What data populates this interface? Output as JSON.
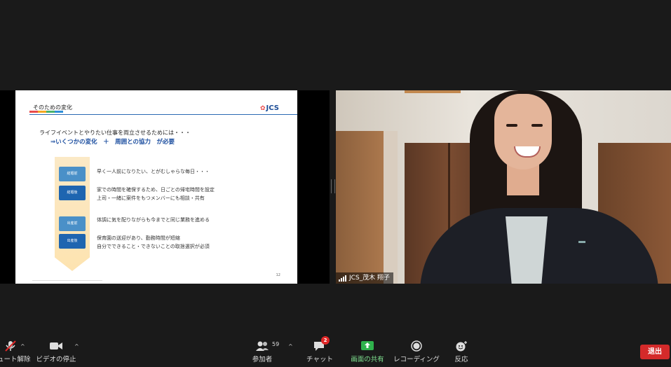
{
  "slide": {
    "title": "そのための変化",
    "logo": "JCS",
    "intro": "ライフイベントとやりたい仕事を両立させるためには・・・",
    "emphasis": "⇒いくつかの変化　＋　周囲との協力　が必要",
    "chips": [
      "結婚前",
      "結婚後",
      "出産前",
      "出産後"
    ],
    "lines": [
      "早く一人前になりたい、とがむしゃらな毎日・・・",
      "家での時間を確保するため、日ごとの帰宅時間を設定",
      "上司・一緒に案件をもつメンバーにも相談・共有",
      "体調に気を配りながらも今までと同じ業務を進める",
      "保育園の送迎があり、勤務時間が短縮",
      "自分でできること・できないことの取捨選択が必須"
    ],
    "page_number": "12"
  },
  "participant": {
    "name": "JCS_茂木 翔子"
  },
  "toolbar": {
    "mute_label": "ミュート解除",
    "video_label": "ビデオの停止",
    "participants_label": "参加者",
    "participants_count": "59",
    "chat_label": "チャット",
    "chat_badge": "2",
    "share_label": "画面の共有",
    "record_label": "レコーディング",
    "reactions_label": "反応",
    "leave_label": "退出"
  },
  "colors": {
    "share_green": "#2fb24c",
    "leave_red": "#d42a2a",
    "badge_red": "#e02828"
  }
}
